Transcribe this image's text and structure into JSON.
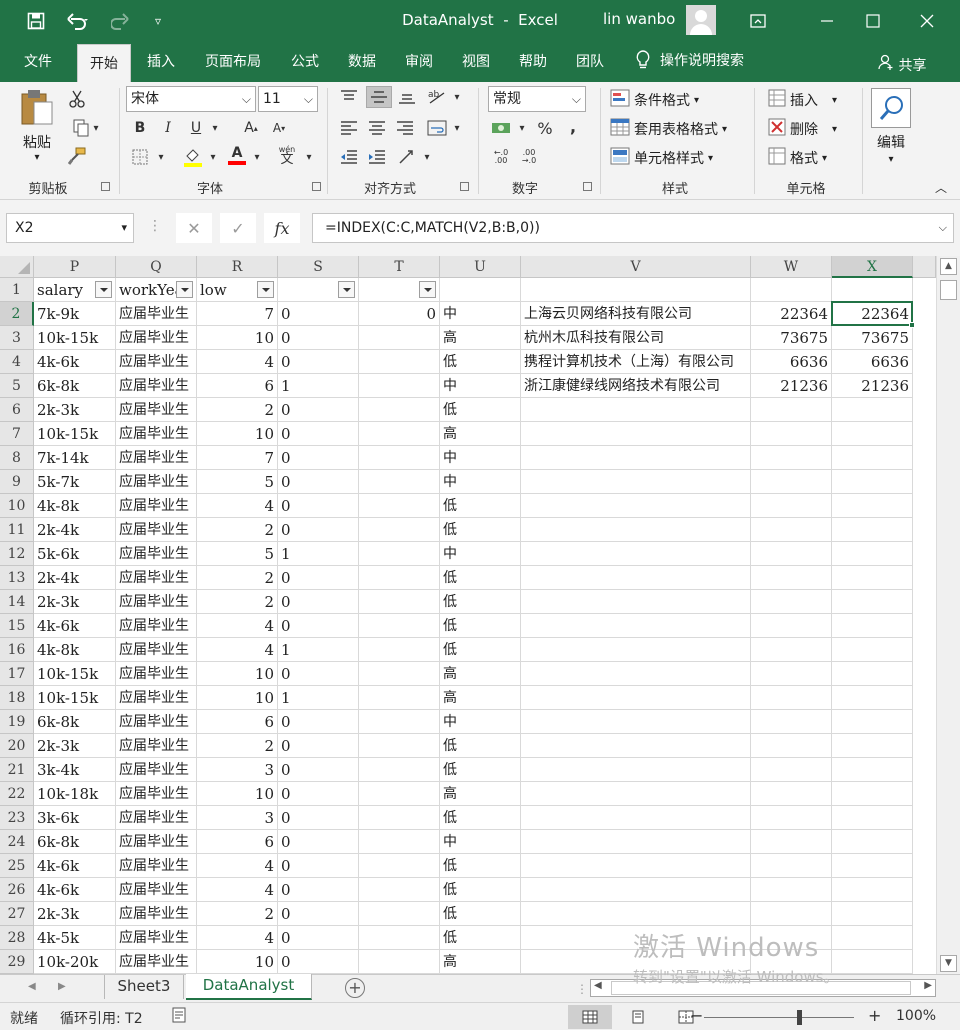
{
  "app": {
    "doc_title": "DataAnalyst",
    "app_name": "Excel",
    "title_separator": "-",
    "user": "lin wanbo"
  },
  "tabs": [
    "文件",
    "开始",
    "插入",
    "页面布局",
    "公式",
    "数据",
    "审阅",
    "视图",
    "帮助",
    "团队"
  ],
  "active_tab": "开始",
  "tell_me": "操作说明搜索",
  "share": "共享",
  "ribbon": {
    "clipboard": {
      "label": "剪贴板",
      "paste": "粘贴"
    },
    "font": {
      "label": "字体",
      "name": "宋体",
      "size": "11",
      "bold": "B",
      "italic": "I",
      "underline": "U",
      "grow": "A",
      "shrink": "A",
      "font_color_glyph": "A",
      "phonetic": "wén"
    },
    "alignment": {
      "label": "对齐方式"
    },
    "number": {
      "label": "数字",
      "format": "常规",
      "percent": "%",
      "comma": ","
    },
    "styles": {
      "label": "样式",
      "conditional": "条件格式",
      "as_table": "套用表格格式",
      "cell_styles": "单元格样式"
    },
    "cells": {
      "label": "单元格",
      "insert": "插入",
      "delete": "删除",
      "format": "格式"
    },
    "editing": {
      "label": "编辑"
    }
  },
  "formula_bar": {
    "name_box": "X2",
    "formula": "=INDEX(C:C,MATCH(V2,B:B,0))",
    "fx": "fx"
  },
  "columns": [
    "P",
    "Q",
    "R",
    "S",
    "T",
    "U",
    "V",
    "W",
    "X"
  ],
  "selected_column": "X",
  "selected_row": "2",
  "row_numbers": [
    "1",
    "2",
    "3",
    "4",
    "5",
    "6",
    "7",
    "8",
    "9",
    "10",
    "11",
    "12",
    "13",
    "14",
    "15",
    "16",
    "17",
    "18",
    "19",
    "20",
    "21",
    "22",
    "23",
    "24",
    "25",
    "26",
    "27",
    "28",
    "29"
  ],
  "header_row": {
    "P": "salary",
    "Q": "workYear",
    "R": "low",
    "S": "",
    "T": ""
  },
  "rows": [
    {
      "P": "7k-9k",
      "Q": "应届毕业生",
      "R": "7",
      "S": "0",
      "T": "0",
      "U": "中",
      "V": "上海云贝网络科技有限公司",
      "W": "22364",
      "X": "22364"
    },
    {
      "P": "10k-15k",
      "Q": "应届毕业生",
      "R": "10",
      "S": "0",
      "U": "高",
      "V": "杭州木瓜科技有限公司",
      "W": "73675",
      "X": "73675"
    },
    {
      "P": "4k-6k",
      "Q": "应届毕业生",
      "R": "4",
      "S": "0",
      "U": "低",
      "V": "携程计算机技术（上海）有限公司",
      "W": "6636",
      "X": "6636"
    },
    {
      "P": "6k-8k",
      "Q": "应届毕业生",
      "R": "6",
      "S": "1",
      "U": "中",
      "V": "浙江康健绿线网络技术有限公司",
      "W": "21236",
      "X": "21236"
    },
    {
      "P": "2k-3k",
      "Q": "应届毕业生",
      "R": "2",
      "S": "0",
      "U": "低"
    },
    {
      "P": "10k-15k",
      "Q": "应届毕业生",
      "R": "10",
      "S": "0",
      "U": "高"
    },
    {
      "P": "7k-14k",
      "Q": "应届毕业生",
      "R": "7",
      "S": "0",
      "U": "中"
    },
    {
      "P": "5k-7k",
      "Q": "应届毕业生",
      "R": "5",
      "S": "0",
      "U": "中"
    },
    {
      "P": "4k-8k",
      "Q": "应届毕业生",
      "R": "4",
      "S": "0",
      "U": "低"
    },
    {
      "P": "2k-4k",
      "Q": "应届毕业生",
      "R": "2",
      "S": "0",
      "U": "低"
    },
    {
      "P": "5k-6k",
      "Q": "应届毕业生",
      "R": "5",
      "S": "1",
      "U": "中"
    },
    {
      "P": "2k-4k",
      "Q": "应届毕业生",
      "R": "2",
      "S": "0",
      "U": "低"
    },
    {
      "P": "2k-3k",
      "Q": "应届毕业生",
      "R": "2",
      "S": "0",
      "U": "低"
    },
    {
      "P": "4k-6k",
      "Q": "应届毕业生",
      "R": "4",
      "S": "0",
      "U": "低"
    },
    {
      "P": "4k-8k",
      "Q": "应届毕业生",
      "R": "4",
      "S": "1",
      "U": "低"
    },
    {
      "P": "10k-15k",
      "Q": "应届毕业生",
      "R": "10",
      "S": "0",
      "U": "高"
    },
    {
      "P": "10k-15k",
      "Q": "应届毕业生",
      "R": "10",
      "S": "1",
      "U": "高"
    },
    {
      "P": "6k-8k",
      "Q": "应届毕业生",
      "R": "6",
      "S": "0",
      "U": "中"
    },
    {
      "P": "2k-3k",
      "Q": "应届毕业生",
      "R": "2",
      "S": "0",
      "U": "低"
    },
    {
      "P": "3k-4k",
      "Q": "应届毕业生",
      "R": "3",
      "S": "0",
      "U": "低"
    },
    {
      "P": "10k-18k",
      "Q": "应届毕业生",
      "R": "10",
      "S": "0",
      "U": "高"
    },
    {
      "P": "3k-6k",
      "Q": "应届毕业生",
      "R": "3",
      "S": "0",
      "U": "低"
    },
    {
      "P": "6k-8k",
      "Q": "应届毕业生",
      "R": "6",
      "S": "0",
      "U": "中"
    },
    {
      "P": "4k-6k",
      "Q": "应届毕业生",
      "R": "4",
      "S": "0",
      "U": "低"
    },
    {
      "P": "4k-6k",
      "Q": "应届毕业生",
      "R": "4",
      "S": "0",
      "U": "低"
    },
    {
      "P": "2k-3k",
      "Q": "应届毕业生",
      "R": "2",
      "S": "0",
      "U": "低"
    },
    {
      "P": "4k-5k",
      "Q": "应届毕业生",
      "R": "4",
      "S": "0",
      "U": "低"
    },
    {
      "P": "10k-20k",
      "Q": "应届毕业生",
      "R": "10",
      "S": "0",
      "U": "高"
    }
  ],
  "sheets": [
    "Sheet3",
    "DataAnalyst"
  ],
  "active_sheet": "DataAnalyst",
  "status": {
    "ready": "就绪",
    "circular": "循环引用: T2",
    "zoom": "100%"
  },
  "watermark": {
    "line1": "激活 Windows",
    "line2": "转到\"设置\"以激活 Windows。"
  },
  "colors": {
    "excel_green": "#217346",
    "ribbon_bg": "#f3f3f3"
  }
}
